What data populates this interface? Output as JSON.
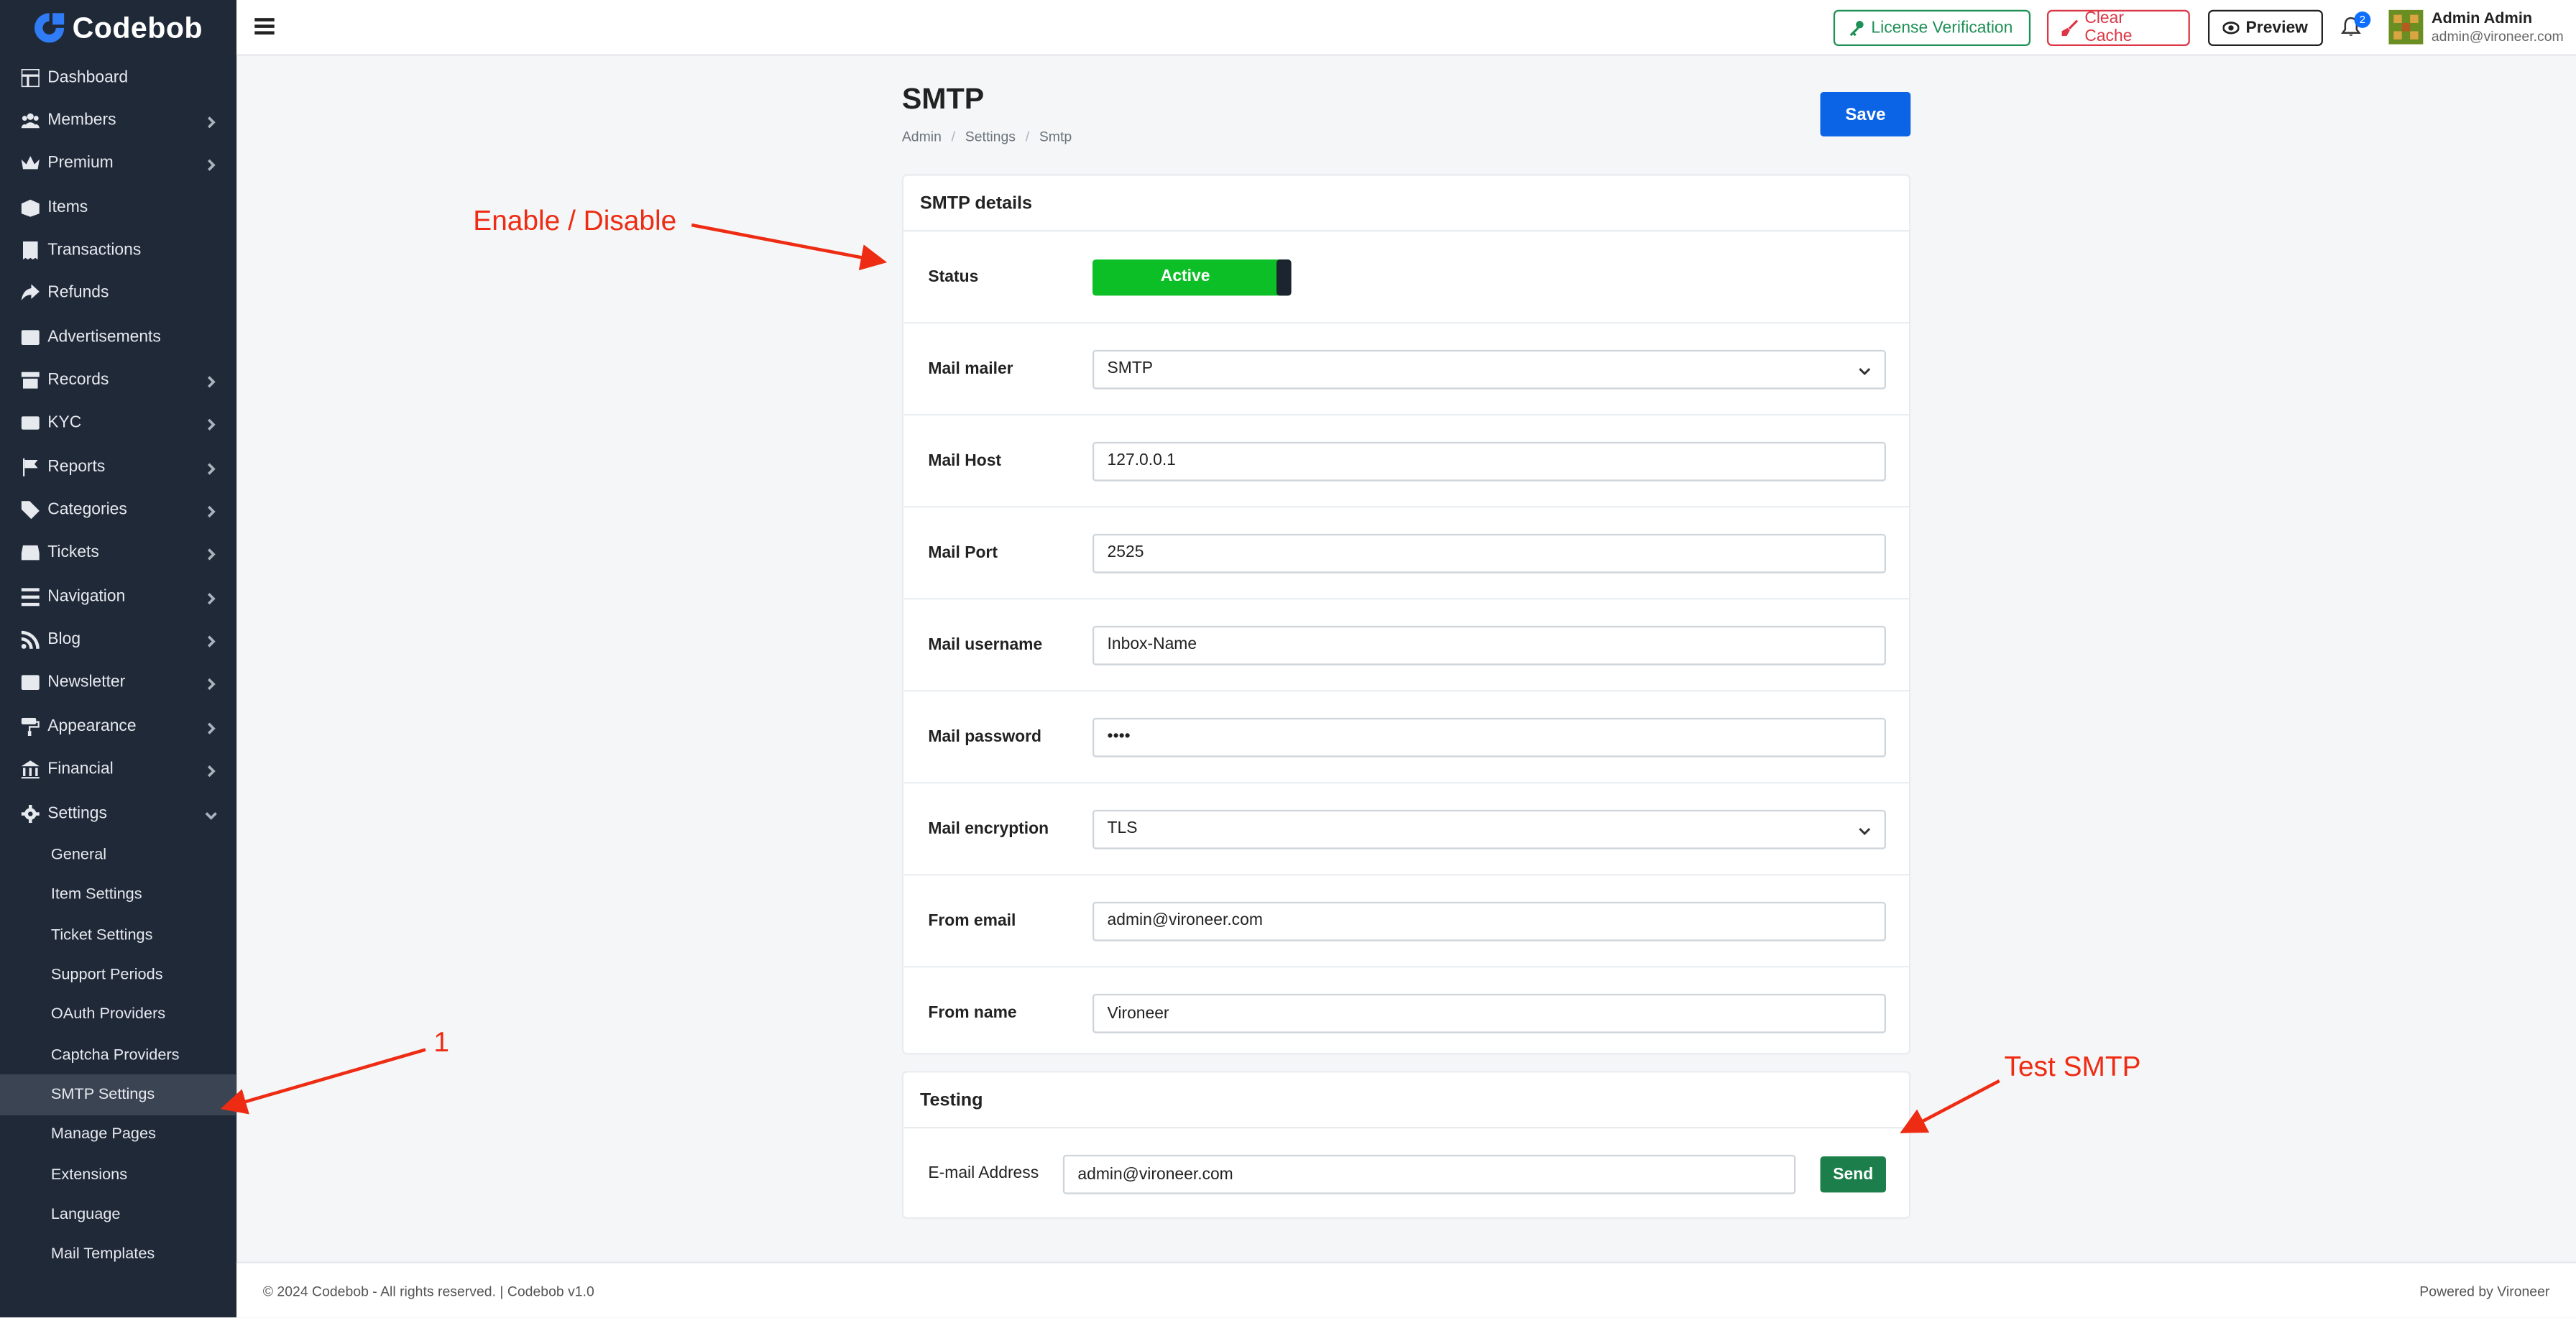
{
  "brand": {
    "name": "Codebob"
  },
  "sidebar": {
    "items": [
      {
        "label": "Dashboard",
        "icon": "dashboard-icon",
        "has_children": false
      },
      {
        "label": "Members",
        "icon": "users-icon",
        "has_children": true
      },
      {
        "label": "Premium",
        "icon": "crown-icon",
        "has_children": true
      },
      {
        "label": "Items",
        "icon": "box-icon",
        "has_children": false
      },
      {
        "label": "Transactions",
        "icon": "receipt-icon",
        "has_children": false
      },
      {
        "label": "Refunds",
        "icon": "share-icon",
        "has_children": false
      },
      {
        "label": "Advertisements",
        "icon": "ad-icon",
        "has_children": false
      },
      {
        "label": "Records",
        "icon": "archive-icon",
        "has_children": true
      },
      {
        "label": "KYC",
        "icon": "id-card-icon",
        "has_children": true
      },
      {
        "label": "Reports",
        "icon": "flag-icon",
        "has_children": true
      },
      {
        "label": "Categories",
        "icon": "tags-icon",
        "has_children": true
      },
      {
        "label": "Tickets",
        "icon": "inbox-icon",
        "has_children": true
      },
      {
        "label": "Navigation",
        "icon": "compass-icon",
        "has_children": true
      },
      {
        "label": "Blog",
        "icon": "rss-icon",
        "has_children": true
      },
      {
        "label": "Newsletter",
        "icon": "envelope-icon",
        "has_children": true
      },
      {
        "label": "Appearance",
        "icon": "paint-roller-icon",
        "has_children": true
      },
      {
        "label": "Financial",
        "icon": "bank-icon",
        "has_children": true
      },
      {
        "label": "Settings",
        "icon": "gear-icon",
        "has_children": true,
        "expanded": true
      }
    ],
    "settings_sub": [
      "General",
      "Item Settings",
      "Ticket Settings",
      "Support Periods",
      "OAuth Providers",
      "Captcha Providers",
      "SMTP Settings",
      "Manage Pages",
      "Extensions",
      "Language",
      "Mail Templates"
    ],
    "active_sub": "SMTP Settings"
  },
  "topbar": {
    "license_label": "License Verification",
    "cache_label": "Clear Cache",
    "preview_label": "Preview",
    "notifications_count": "2",
    "user_name": "Admin Admin",
    "user_email": "admin@vironeer.com"
  },
  "page": {
    "title": "SMTP",
    "breadcrumb": [
      "Admin",
      "Settings",
      "Smtp"
    ],
    "save_label": "Save"
  },
  "smtp": {
    "header": "SMTP details",
    "status_label": "Status",
    "status_value": "Active",
    "fields": [
      {
        "label": "Mail mailer",
        "value": "SMTP",
        "type": "select"
      },
      {
        "label": "Mail Host",
        "value": "127.0.0.1",
        "type": "text"
      },
      {
        "label": "Mail Port",
        "value": "2525",
        "type": "text"
      },
      {
        "label": "Mail username",
        "value": "Inbox-Name",
        "type": "text"
      },
      {
        "label": "Mail password",
        "value": "••••",
        "type": "password"
      },
      {
        "label": "Mail encryption",
        "value": "TLS",
        "type": "select"
      },
      {
        "label": "From email",
        "value": "admin@vironeer.com",
        "type": "text"
      },
      {
        "label": "From name",
        "value": "Vironeer",
        "type": "text"
      }
    ]
  },
  "testing": {
    "header": "Testing",
    "email_label": "E-mail Address",
    "email_value": "admin@vironeer.com",
    "send_label": "Send"
  },
  "annotations": {
    "enable_disable": "Enable / Disable",
    "step_one": "1",
    "test_smtp": "Test SMTP"
  },
  "footer": {
    "left": "© 2024 Codebob - All rights reserved. | Codebob v1.0",
    "right": "Powered by Vironeer"
  },
  "colors": {
    "sidebar_bg": "#202938",
    "primary": "#0b63e5",
    "active_green": "#0cbf27",
    "send_green": "#1b7e4b",
    "annotation_red": "#ee2c13"
  }
}
